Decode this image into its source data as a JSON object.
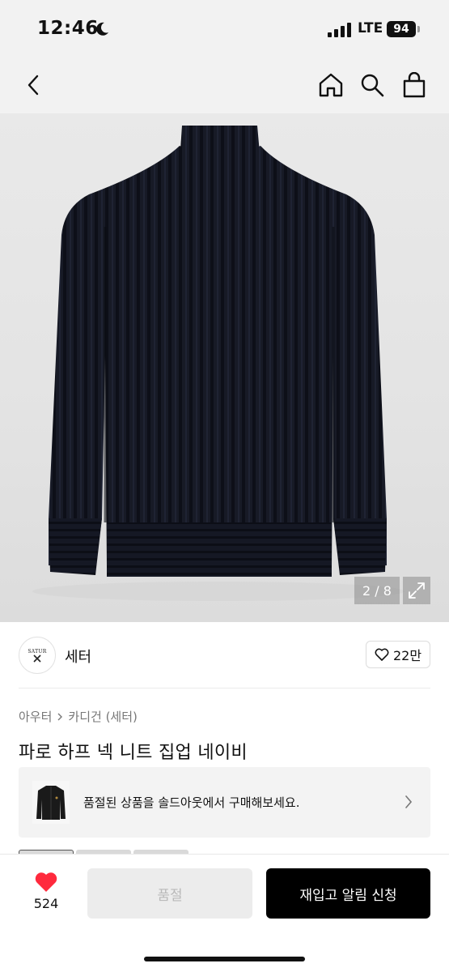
{
  "status_bar": {
    "time": "12:46",
    "network": "LTE",
    "battery": "94"
  },
  "navbar": {
    "icons": [
      "back-icon",
      "home-icon",
      "search-icon",
      "shopping-bag-icon"
    ]
  },
  "gallery": {
    "counter": "2 / 8",
    "current": 2,
    "total": 8
  },
  "brand": {
    "logo_text": "SATUR",
    "name": "세터",
    "likes": "22만"
  },
  "breadcrumb": {
    "items": [
      "아우터",
      "카디건 (세터)"
    ]
  },
  "product": {
    "title": "파로 하프 넥 니트 집업 네이비"
  },
  "soldout_banner": {
    "text": "품절된 상품을 솔드아웃에서 구매해보세요."
  },
  "bottom_bar": {
    "like_count": "524",
    "soldout_label": "품절",
    "restock_label": "재입고 알림 신청"
  },
  "colors": {
    "accent_heart": "#ff2a3d",
    "primary_button": "#000000",
    "disabled_button": "#ececec"
  }
}
